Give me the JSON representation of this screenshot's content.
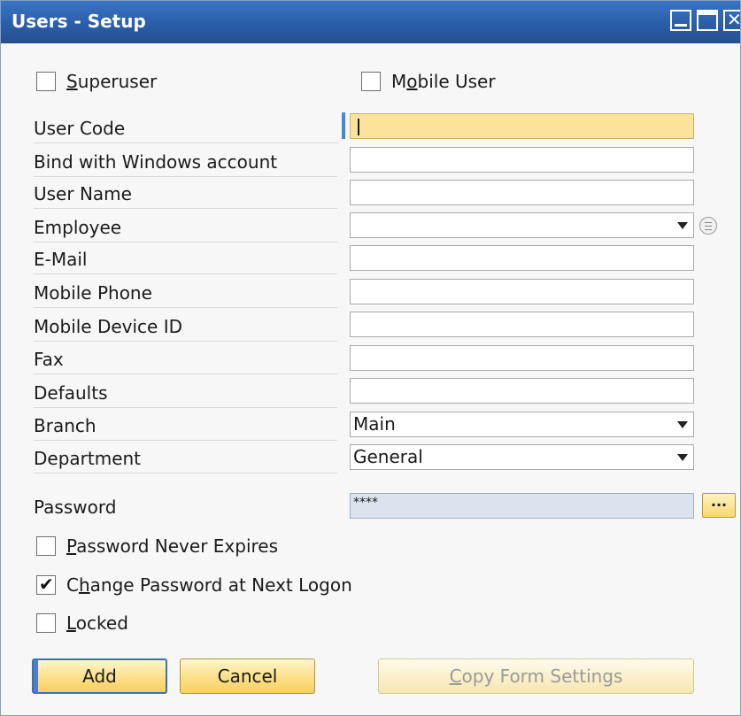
{
  "window": {
    "title": "Users - Setup"
  },
  "top_checkboxes": {
    "superuser": {
      "label_pre": "",
      "label_u": "S",
      "label_post": "uperuser",
      "checked": false
    },
    "mobile_user": {
      "label_pre": "M",
      "label_u": "o",
      "label_post": "bile User",
      "checked": false
    }
  },
  "fields": {
    "user_code": {
      "label": "User Code",
      "value": ""
    },
    "bind_windows": {
      "label": "Bind with Windows account",
      "value": ""
    },
    "user_name": {
      "label": "User Name",
      "value": ""
    },
    "employee": {
      "label": "Employee",
      "value": ""
    },
    "email": {
      "label": "E-Mail",
      "value": ""
    },
    "mobile_phone": {
      "label": "Mobile Phone",
      "value": ""
    },
    "mobile_device_id": {
      "label": "Mobile Device ID",
      "value": ""
    },
    "fax": {
      "label": "Fax",
      "value": ""
    },
    "defaults": {
      "label": "Defaults",
      "value": ""
    },
    "branch": {
      "label": "Branch",
      "value": "Main"
    },
    "department": {
      "label": "Department",
      "value": "General"
    },
    "password": {
      "label": "Password",
      "value": "****"
    }
  },
  "bottom_checkboxes": {
    "password_never_expires": {
      "label_pre": "",
      "label_u": "P",
      "label_post": "assword Never Expires",
      "checked": false
    },
    "change_password": {
      "label_pre": "C",
      "label_u": "h",
      "label_post": "ange Password at Next Logon",
      "checked": true
    },
    "locked": {
      "label_pre": "",
      "label_u": "L",
      "label_post": "ocked",
      "checked": false
    }
  },
  "buttons": {
    "add": "Add",
    "cancel": "Cancel",
    "ellipsis": "...",
    "copy_pre": "",
    "copy_u": "C",
    "copy_post": "opy Form Settings"
  },
  "icons": {
    "dropdown": "chevron-down-icon",
    "link": "link-arrow-icon",
    "check": "✔"
  }
}
